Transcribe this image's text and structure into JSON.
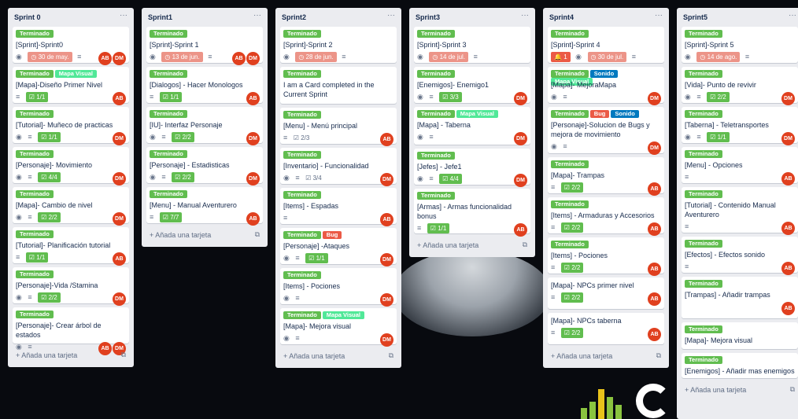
{
  "colors": {
    "green": "#61bd4f",
    "teal": "#51e898",
    "red": "#eb5a46",
    "blue": "#0079bf",
    "due": "#ec9488",
    "avatar": "#e0401f"
  },
  "add_label": "+ Añada una tarjeta",
  "labels": {
    "done": "Terminado",
    "visual": "Mapa Visual",
    "bug": "Bug",
    "sound": "Sonido"
  },
  "avatars": {
    "ab": "AB",
    "dm": "DM"
  },
  "lists": [
    {
      "title": "Sprint 0",
      "cards": [
        {
          "title": "[Sprint]-Sprint0",
          "due": "30 de may.",
          "ab": true,
          "dm": true
        },
        {
          "title": "[Mapa]-Diseño Primer Nivel",
          "check": "1/1",
          "ab": true
        },
        {
          "title": "[Tutorial]- Muñeco de practicas",
          "check": "1/1",
          "dm": true
        },
        {
          "title": "[Personaje]- Movimiento",
          "check": "4/4",
          "dm": true
        },
        {
          "title": "[Mapa]- Cambio de nivel",
          "check": "2/2",
          "dm": true
        },
        {
          "title": "[Tutorial]- Planificación tutorial",
          "check": "1/1",
          "ab": true
        },
        {
          "title": "[Personaje]-Vida /Stamina",
          "check": "2/2",
          "dm": true
        },
        {
          "title": "[Personaje]- Crear árbol de estados",
          "ab": true,
          "dm": true
        }
      ]
    },
    {
      "title": "Sprint1",
      "cards": [
        {
          "title": "[Sprint]-Sprint 1",
          "due": "13 de jun.",
          "ab": true,
          "dm": true
        },
        {
          "title": "[Dialogos] - Hacer Monologos",
          "check": "1/1",
          "ab": true
        },
        {
          "title": "[IU]- Interfaz Personaje",
          "check": "2/2",
          "dm": true
        },
        {
          "title": "[Personaje] - Estadisticas",
          "check": "2/2",
          "dm": true
        },
        {
          "title": "[Menu] - Manual Aventurero",
          "check": "7/7",
          "ab": true
        }
      ]
    },
    {
      "title": "Sprint2",
      "cards": [
        {
          "title": "[Sprint]-Sprint 2",
          "due": "28 de jun."
        },
        {
          "title": "I am a Card completed in the Current Sprint"
        },
        {
          "title": "[Menu] - Menú principal",
          "check_plain": "2/3",
          "ab": true
        },
        {
          "title": "[Inventario] - Funcionalidad",
          "check_plain": "3/4",
          "dm": true
        },
        {
          "title": "[Items] - Espadas",
          "ab": true
        },
        {
          "title": "[Personaje] -Ataques",
          "check": "1/1",
          "dm": true
        },
        {
          "title": "[Items] - Pociones",
          "dm": true
        },
        {
          "title": "[Mapa]- Mejora visual",
          "dm": true
        }
      ]
    },
    {
      "title": "Sprint3",
      "cards": [
        {
          "title": "[Sprint]-Sprint 3",
          "due": "14 de jul."
        },
        {
          "title": "[Enemigos]- Enemigo1",
          "check": "3/3",
          "dm": true
        },
        {
          "title": "[Mapa] - Taberna",
          "dm": true
        },
        {
          "title": "[Jefes] - Jefe1",
          "check": "4/4",
          "dm": true
        },
        {
          "title": "[Armas] - Armas funcionalidad bonus",
          "check": "1/1",
          "ab": true
        }
      ]
    },
    {
      "title": "Sprint4",
      "cards": [
        {
          "title": "[Sprint]-Sprint 4",
          "alert": "1",
          "due": "30 de jul."
        },
        {
          "title": "[Mapa]- MejoraMapa",
          "dm": true
        },
        {
          "title": "[Personaje]-Solucion de Bugs y mejora de movimiento",
          "dm": true
        },
        {
          "title": "[Mapa]- Trampas",
          "check": "2/2",
          "ab": true
        },
        {
          "title": "[Items] - Armaduras y Accesorios",
          "check": "2/2",
          "ab": true
        },
        {
          "title": "[Items] - Pociones",
          "check": "2/2",
          "ab": true
        },
        {
          "title": "[Mapa]- NPCs primer nivel",
          "check": "2/2",
          "ab": true
        },
        {
          "title": "[Mapa]- NPCs taberna",
          "check": "2/2",
          "ab": true
        }
      ]
    },
    {
      "title": "Sprint5",
      "cards": [
        {
          "title": "[Sprint]-Sprint 5",
          "due": "14 de ago."
        },
        {
          "title": "[Vida]- Punto de revivir",
          "check": "2/2",
          "dm": true
        },
        {
          "title": "[Taberna] - Teletransportes",
          "check": "1/1",
          "dm": true
        },
        {
          "title": "[Menu] - Opciones",
          "ab": true
        },
        {
          "title": "[Tutorial] - Contenido Manual Aventurero",
          "ab": true
        },
        {
          "title": "[Efectos] - Efectos sonido",
          "ab": true
        },
        {
          "title": "[Trampas] - Añadir trampas",
          "ab": true
        },
        {
          "title": "[Mapa]- Mejora visual"
        },
        {
          "title": "[Enemigos] - Añadir mas enemigos"
        }
      ]
    }
  ]
}
